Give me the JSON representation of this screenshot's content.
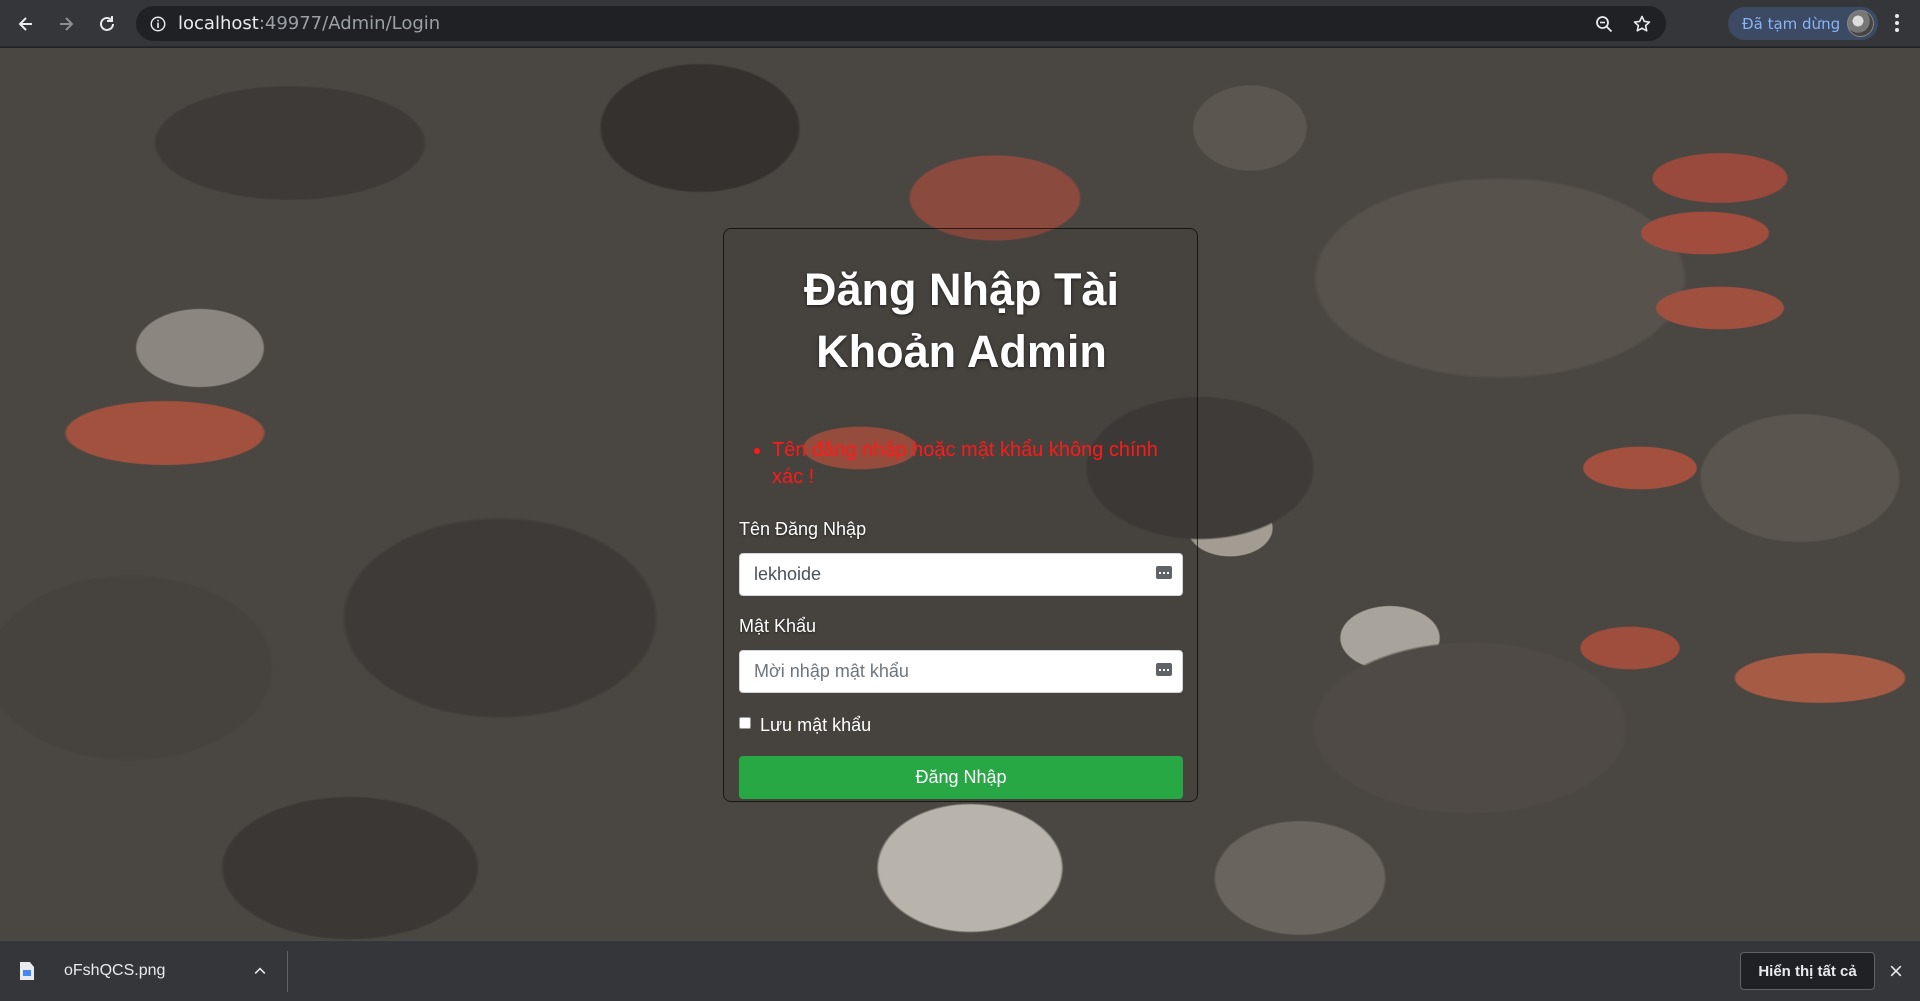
{
  "browser": {
    "url_host": "localhost",
    "url_rest": ":49977/Admin/Login",
    "profile_label": "Đã tạm dừng"
  },
  "login": {
    "title": "Đăng Nhập Tài Khoản Admin",
    "errors": [
      "Tên đăng nhập hoặc mật khẩu không chính xác !"
    ],
    "username_label": "Tên Đăng Nhập",
    "username_value": "lekhoide",
    "password_label": "Mật Khẩu",
    "password_placeholder": "Mời nhập mật khẩu",
    "remember_label": "Lưu mật khẩu",
    "submit_label": "Đăng Nhập"
  },
  "downloads": {
    "file_name": "oFshQCS.png",
    "show_all_label": "Hiển thị tất cả"
  },
  "colors": {
    "submit_button": "#28a745",
    "error_text": "#ff1a1a"
  }
}
